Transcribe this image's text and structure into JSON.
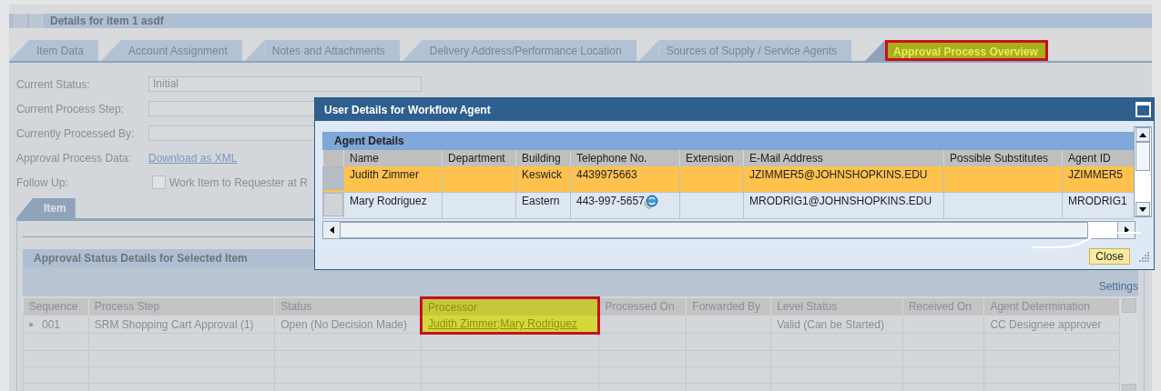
{
  "header": {
    "title": "Details for item 1 asdf"
  },
  "tabs": [
    {
      "label": "Item Data",
      "selected": false,
      "highlighted": false
    },
    {
      "label": "Account Assignment",
      "selected": false,
      "highlighted": false
    },
    {
      "label": "Notes and Attachments",
      "selected": false,
      "highlighted": false
    },
    {
      "label": "Delivery Address/Performance Location",
      "selected": false,
      "highlighted": false
    },
    {
      "label": "Sources of Supply / Service Agents",
      "selected": false,
      "highlighted": false
    },
    {
      "label": "Approval Process Overview",
      "selected": true,
      "highlighted": true
    }
  ],
  "fields": [
    {
      "kind": "input",
      "label": "Current Status:",
      "value": "Initial"
    },
    {
      "kind": "input",
      "label": "Current Process Step:"
    },
    {
      "kind": "input",
      "label": "Currently Processed By:"
    },
    {
      "kind": "link",
      "label": "Approval Process Data:",
      "value": "Download as XML"
    },
    {
      "kind": "checkbox",
      "label": "Follow Up:",
      "value": "Work Item to Requester at R",
      "checked": false
    }
  ],
  "subtabs": [
    {
      "label": "Item",
      "selected": true
    }
  ],
  "approval_table": {
    "title": "Approval Status Details for Selected Item",
    "settings": "Settings",
    "columns": [
      {
        "label": "Sequence",
        "highlighted": false
      },
      {
        "label": "Process Step",
        "highlighted": false
      },
      {
        "label": "Status",
        "highlighted": false
      },
      {
        "label": "Processor",
        "highlighted": true
      },
      {
        "label": "Processed On",
        "highlighted": false
      },
      {
        "label": "Forwarded By",
        "highlighted": false
      },
      {
        "label": "Level Status",
        "highlighted": false
      },
      {
        "label": "Received On",
        "highlighted": false
      },
      {
        "label": "Agent Determination",
        "highlighted": false
      }
    ],
    "rows": [
      {
        "cells": [
          "001",
          "SRM Shopping Cart Approval (1)",
          "Open (No Decision Made)",
          "Judith Zimmer;Mary Rodriguez",
          "",
          "",
          "Valid (Can be Started)",
          "",
          "CC Designee approver"
        ]
      }
    ]
  },
  "dialog": {
    "title": "User Details for Workflow Agent",
    "section": "Agent Details",
    "columns": [
      "Name",
      "Department",
      "Building",
      "Telephone No.",
      "Extension",
      "E-Mail Address",
      "Possible Substitutes",
      "Agent ID"
    ],
    "rows": [
      {
        "selected": true,
        "phone_icon": false,
        "cells": [
          "Judith Zimmer",
          "",
          "Keswick",
          "4439975663",
          "",
          "JZIMMER5@JOHNSHOPKINS.EDU",
          "",
          "JZIMMER5"
        ]
      },
      {
        "selected": false,
        "phone_icon": true,
        "cells": [
          "Mary Rodriguez",
          "",
          "Eastern",
          "443-997-5657",
          "",
          "MRODRIG1@JOHNSHOPKINS.EDU",
          "",
          "MRODRIG1"
        ]
      }
    ],
    "close": "Close"
  }
}
